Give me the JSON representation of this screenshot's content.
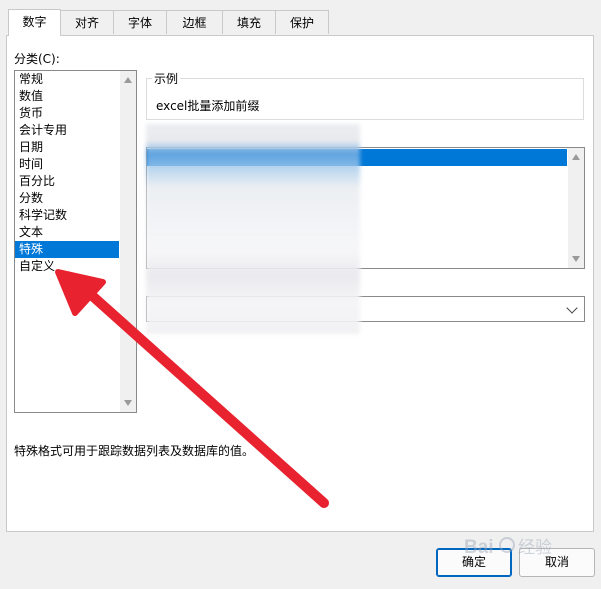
{
  "tabs": [
    {
      "label": "数字",
      "active": true
    },
    {
      "label": "对齐",
      "active": false
    },
    {
      "label": "字体",
      "active": false
    },
    {
      "label": "边框",
      "active": false
    },
    {
      "label": "填充",
      "active": false
    },
    {
      "label": "保护",
      "active": false
    }
  ],
  "category": {
    "label": "分类(C):",
    "items": [
      "常规",
      "数值",
      "货币",
      "会计专用",
      "日期",
      "时间",
      "百分比",
      "分数",
      "科学记数",
      "文本",
      "特殊",
      "自定义"
    ],
    "selected": "特殊"
  },
  "sample": {
    "legend": "示例",
    "value": "excel批量添加前缀"
  },
  "description": "特殊格式可用于跟踪数据列表及数据库的值。",
  "buttons": {
    "ok": "确定",
    "cancel": "取消"
  },
  "watermark": "Baidu 经验",
  "colors": {
    "accent": "#0078d7",
    "annotation_arrow": "#e8222e"
  },
  "icons": [
    "scroll-up-arrow-icon",
    "scroll-down-arrow-icon",
    "dropdown-chevron-icon",
    "annotation-arrow-icon"
  ]
}
